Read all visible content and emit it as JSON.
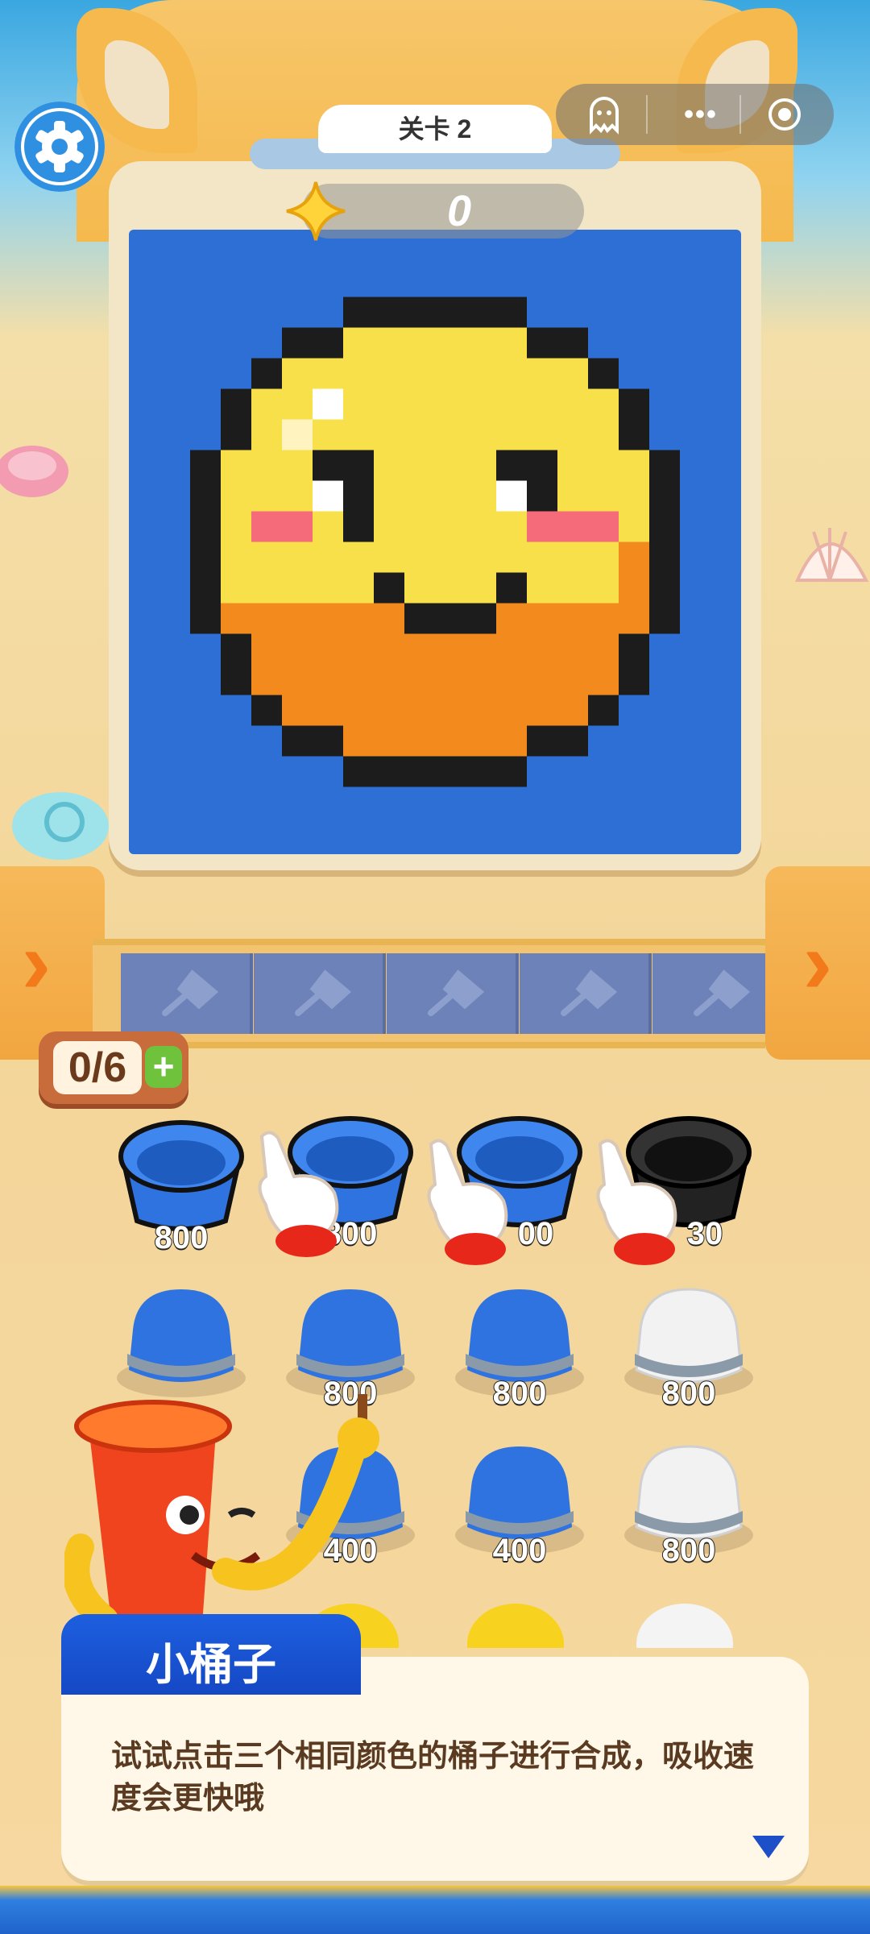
{
  "level": {
    "title": "关卡 2",
    "progress": 0.0
  },
  "stars": {
    "count": "0"
  },
  "counter": {
    "label": "0/6",
    "plus": "+"
  },
  "capsule": {
    "icons": [
      "ghost-icon",
      "more-icon",
      "record-icon"
    ],
    "more": "•••"
  },
  "grid": {
    "rows": [
      [
        {
          "color": "#2e73e0",
          "value": "800",
          "state": "empty"
        },
        {
          "color": "#2e73e0",
          "value": "800",
          "state": "empty"
        },
        {
          "color": "#2e73e0",
          "value": "800",
          "state": "empty"
        },
        {
          "color": "#222222",
          "value": "830",
          "state": "empty"
        }
      ],
      [
        {
          "color": "#2e73e0",
          "value": "",
          "state": "full"
        },
        {
          "color": "#2e73e0",
          "value": "800",
          "state": "full"
        },
        {
          "color": "#2e73e0",
          "value": "800",
          "state": "full"
        },
        {
          "color": "#f2f2f2",
          "value": "800",
          "state": "full"
        }
      ],
      [
        {
          "color": "#2e73e0",
          "value": "",
          "state": "full"
        },
        {
          "color": "#2e73e0",
          "value": "400",
          "state": "full"
        },
        {
          "color": "#2e73e0",
          "value": "400",
          "state": "full"
        },
        {
          "color": "#f2f2f2",
          "value": "800",
          "state": "full"
        }
      ]
    ],
    "visible_labels": {
      "r0c0": "800",
      "r0c1": "800",
      "r0c2": "00",
      "r0c3": "30"
    }
  },
  "dialog": {
    "speaker": "小桶子",
    "text": "试试点击三个相同颜色的桶子进行合成，吸收速度会更快哦"
  },
  "colors": {
    "accent": "#1d5fe0",
    "sand": "#f3d69a",
    "canvas_bg": "#2e6fd6",
    "face": "#f7e04a",
    "blush": "#f56b7a",
    "chin": "#f28a1e"
  }
}
